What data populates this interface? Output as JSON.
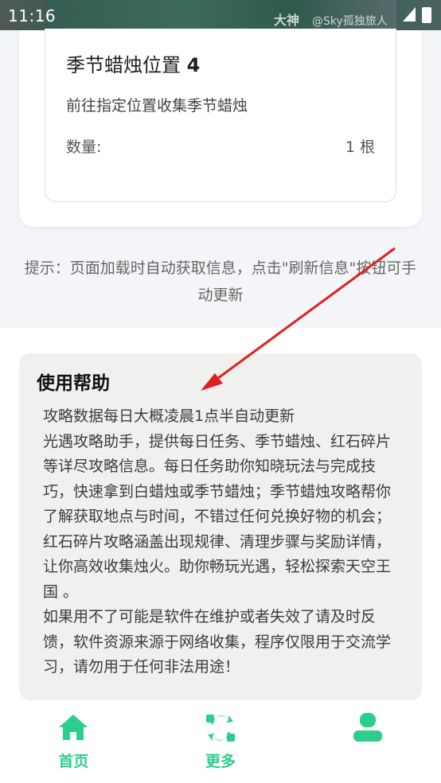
{
  "status_bar": {
    "time": "11:16",
    "watermark_brand": "大神",
    "watermark_user": "@Sky孤独旅人"
  },
  "season_task": {
    "title": "季节蜡烛位置",
    "title_number": "4",
    "description": "前往指定位置收集季节蜡烛",
    "quantity_label": "数量:",
    "quantity_value": "1 根"
  },
  "hint": {
    "text": "提示：页面加载时自动获取信息，点击\"刷新信息\"按钮可手动更新"
  },
  "help": {
    "title": "使用帮助",
    "paragraphs": [
      "攻略数据每日大概凌晨1点半自动更新",
      "光遇攻略助手，提供每日任务、季节蜡烛、红石碎片等详尽攻略信息。每日任务助你知晓玩法与完成技巧，快速拿到白蜡烛或季节蜡烛；季节蜡烛攻略帮你了解获取地点与时间，不错过任何兑换好物的机会；红石碎片攻略涵盖出现规律、清理步骤与奖励详情，让你高效收集烛火。助你畅玩光遇，轻松探索天空王国 。",
      "如果用不了可能是软件在维护或者失效了请及时反馈，软件资源来源于网络收集，程序仅限用于交流学习，请勿用于任何非法用途！"
    ]
  },
  "bottom_nav": {
    "accent_color": "#2bcf8b",
    "items": [
      {
        "label": "首页",
        "icon": "home-icon"
      },
      {
        "label": "更多",
        "icon": "refresh-icon"
      },
      {
        "label": "",
        "icon": "user-icon"
      }
    ]
  },
  "annotation": {
    "arrow_color": "#e02020"
  }
}
